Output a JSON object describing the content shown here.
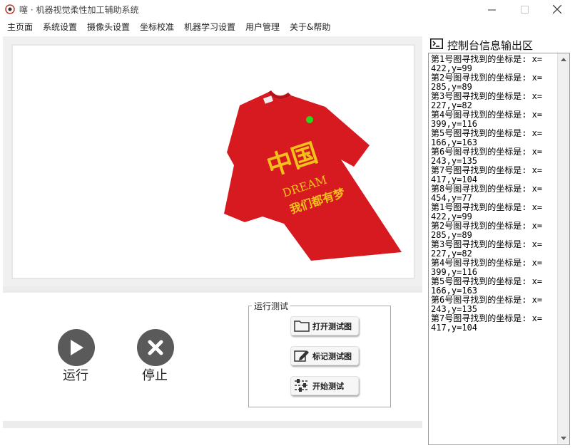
{
  "window": {
    "title": "噻 · 机器视觉柔性加工辅助系统"
  },
  "menu": [
    "主页面",
    "系统设置",
    "摄像头设置",
    "坐标校准",
    "机器学习设置",
    "用户管理",
    "关于&帮助"
  ],
  "image_view": {
    "shirt_print_lines": [
      "中国",
      "DREAM",
      "我们都有梦"
    ],
    "marker_color": "#27d81f",
    "shirt_color": "#d71920",
    "print_color": "#f2c21b"
  },
  "controls": {
    "run_label": "运行",
    "stop_label": "停止",
    "test_group_title": "运行测试",
    "open_test_image": "打开测试图",
    "mark_test_image": "标记测试图",
    "start_test": "开始测试"
  },
  "console": {
    "title": "控制台信息输出区",
    "lines": [
      "第1号图寻找到的坐标是: x=",
      "422,y=99",
      "第2号图寻找到的坐标是: x=",
      "285,y=89",
      "第3号图寻找到的坐标是: x=",
      "227,y=82",
      "第4号图寻找到的坐标是: x=",
      "399,y=116",
      "第5号图寻找到的坐标是: x=",
      "166,y=163",
      "第6号图寻找到的坐标是: x=",
      "243,y=135",
      "第7号图寻找到的坐标是: x=",
      "417,y=104",
      "第8号图寻找到的坐标是: x=",
      "454,y=77",
      "第1号图寻找到的坐标是: x=",
      "422,y=99",
      "第2号图寻找到的坐标是: x=",
      "285,y=89",
      "第3号图寻找到的坐标是: x=",
      "227,y=82",
      "第4号图寻找到的坐标是: x=",
      "399,y=116",
      "第5号图寻找到的坐标是: x=",
      "166,y=163",
      "第6号图寻找到的坐标是: x=",
      "243,y=135",
      "第7号图寻找到的坐标是: x=",
      "417,y=104"
    ]
  }
}
